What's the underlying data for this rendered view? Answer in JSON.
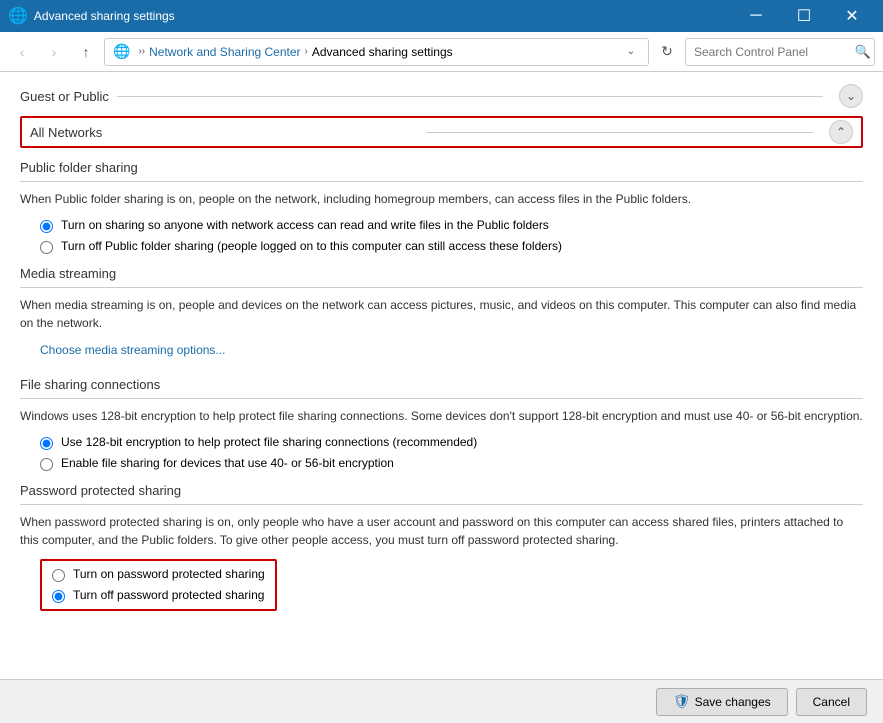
{
  "titlebar": {
    "title": "Advanced sharing settings",
    "icon": "🌐",
    "buttons": {
      "minimize": "─",
      "maximize": "☐",
      "close": "✕"
    }
  },
  "addressbar": {
    "back": "‹",
    "forward": "›",
    "up": "↑",
    "breadcrumb": {
      "home": "🌐",
      "items": [
        "Network and Sharing Center",
        "Advanced sharing settings"
      ]
    },
    "refresh": "↻",
    "search_placeholder": "Search Control Panel",
    "search_icon": "🔍"
  },
  "sections": {
    "guest_public": {
      "title": "Guest or Public",
      "toggle": "⌄"
    },
    "all_networks": {
      "title": "All Networks",
      "toggle": "⌃",
      "public_folder": {
        "title": "Public folder sharing",
        "description": "When Public folder sharing is on, people on the network, including homegroup members, can access files in the Public folders.",
        "options": [
          {
            "label": "Turn on sharing so anyone with network access can read and write files in the Public folders",
            "selected": true
          },
          {
            "label": "Turn off Public folder sharing (people logged on to this computer can still access these folders)",
            "selected": false
          }
        ]
      },
      "media_streaming": {
        "title": "Media streaming",
        "description": "When media streaming is on, people and devices on the network can access pictures, music, and videos on this computer. This computer can also find media on the network.",
        "link": "Choose media streaming options..."
      },
      "file_sharing": {
        "title": "File sharing connections",
        "description": "Windows uses 128-bit encryption to help protect file sharing connections. Some devices don't support 128-bit encryption and must use 40- or 56-bit encryption.",
        "options": [
          {
            "label": "Use 128-bit encryption to help protect file sharing connections (recommended)",
            "selected": true
          },
          {
            "label": "Enable file sharing for devices that use 40- or 56-bit encryption",
            "selected": false
          }
        ]
      },
      "password_protected": {
        "title": "Password protected sharing",
        "description": "When password protected sharing is on, only people who have a user account and password on this computer can access shared files, printers attached to this computer, and the Public folders. To give other people access, you must turn off password protected sharing.",
        "options": [
          {
            "label": "Turn on password protected sharing",
            "selected": false
          },
          {
            "label": "Turn off password protected sharing",
            "selected": true
          }
        ]
      }
    }
  },
  "footer": {
    "save_label": "Save changes",
    "cancel_label": "Cancel",
    "shield": "🛡"
  }
}
